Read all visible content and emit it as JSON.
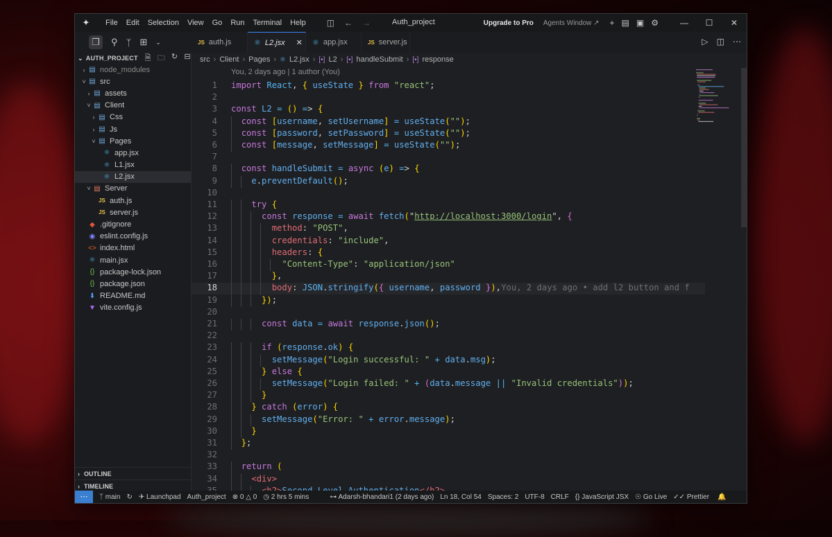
{
  "titlebar": {
    "menu": [
      "File",
      "Edit",
      "Selection",
      "View",
      "Go",
      "Run",
      "Terminal",
      "Help"
    ],
    "window_title": "Auth_project",
    "upgrade": "Upgrade to Pro",
    "agents": "Agents Window ↗"
  },
  "tabs": [
    {
      "label": "auth.js",
      "icon": "js-icon",
      "active": false
    },
    {
      "label": "L2.jsx",
      "icon": "react-icon",
      "active": true
    },
    {
      "label": "app.jsx",
      "icon": "react-icon",
      "active": false
    },
    {
      "label": "server.js",
      "icon": "js-icon",
      "active": false
    }
  ],
  "sidebar": {
    "title": "AUTH_PROJECT",
    "items": [
      {
        "label": "node_modules",
        "depth": 0,
        "type": "folder",
        "open": false,
        "dim": true
      },
      {
        "label": "src",
        "depth": 0,
        "type": "folder",
        "open": true
      },
      {
        "label": "assets",
        "depth": 1,
        "type": "folder",
        "open": false
      },
      {
        "label": "Client",
        "depth": 1,
        "type": "folder",
        "open": true
      },
      {
        "label": "Css",
        "depth": 2,
        "type": "folder",
        "open": false
      },
      {
        "label": "Js",
        "depth": 2,
        "type": "folder",
        "open": false
      },
      {
        "label": "Pages",
        "depth": 2,
        "type": "folder",
        "open": true
      },
      {
        "label": "app.jsx",
        "depth": 3,
        "type": "react"
      },
      {
        "label": "L1.jsx",
        "depth": 3,
        "type": "react"
      },
      {
        "label": "L2.jsx",
        "depth": 3,
        "type": "react",
        "selected": true
      },
      {
        "label": "Server",
        "depth": 1,
        "type": "folder-red",
        "open": true
      },
      {
        "label": "auth.js",
        "depth": 2,
        "type": "js"
      },
      {
        "label": "server.js",
        "depth": 2,
        "type": "js"
      },
      {
        "label": ".gitignore",
        "depth": 0,
        "type": "git"
      },
      {
        "label": "eslint.config.js",
        "depth": 0,
        "type": "eslint"
      },
      {
        "label": "index.html",
        "depth": 0,
        "type": "html"
      },
      {
        "label": "main.jsx",
        "depth": 0,
        "type": "react"
      },
      {
        "label": "package-lock.json",
        "depth": 0,
        "type": "json"
      },
      {
        "label": "package.json",
        "depth": 0,
        "type": "json"
      },
      {
        "label": "README.md",
        "depth": 0,
        "type": "md"
      },
      {
        "label": "vite.config.js",
        "depth": 0,
        "type": "vite"
      }
    ],
    "outline": "OUTLINE",
    "timeline": "TIMELINE"
  },
  "breadcrumb": [
    "src",
    "Client",
    "Pages",
    "L2.jsx",
    "L2",
    "handleSubmit",
    "response"
  ],
  "editor": {
    "blame_header": "You, 2 days ago | 1 author (You)",
    "current_line": 18,
    "inline_blame": "You, 2 days ago • add l2 button and f",
    "lines": [
      "import React, { useState } from \"react\";",
      "",
      "const L2 = () => {",
      "  const [username, setUsername] = useState(\"\");",
      "  const [password, setPassword] = useState(\"\");",
      "  const [message, setMessage] = useState(\"\");",
      "",
      "  const handleSubmit = async (e) => {",
      "    e.preventDefault();",
      "",
      "    try {",
      "      const response = await fetch(\"http://localhost:3000/login\", {",
      "        method: \"POST\",",
      "        credentials: \"include\",",
      "        headers: {",
      "          \"Content-Type\": \"application/json\"",
      "        },",
      "        body: JSON.stringify({ username, password }),",
      "      });",
      "",
      "      const data = await response.json();",
      "",
      "      if (response.ok) {",
      "        setMessage(\"Login successful: \" + data.msg);",
      "      } else {",
      "        setMessage(\"Login failed: \" + (data.message || \"Invalid credentials\"));",
      "      }",
      "    } catch (error) {",
      "      setMessage(\"Error: \" + error.message);",
      "    }",
      "  };",
      "",
      "  return (",
      "    <div>",
      "      <h2>Second Level Authentication</h2>"
    ]
  },
  "statusbar": {
    "branch": "main",
    "launchpad": "Launchpad",
    "project": "Auth_project",
    "errors": "0",
    "warnings": "0",
    "time": "2 hrs 5 mins",
    "blame": "Adarsh-bhandari1 (2 days ago)",
    "position": "Ln 18, Col 54",
    "spaces": "Spaces: 2",
    "encoding": "UTF-8",
    "eol": "CRLF",
    "language": "JavaScript JSX",
    "golive": "Go Live",
    "prettier": "Prettier"
  }
}
